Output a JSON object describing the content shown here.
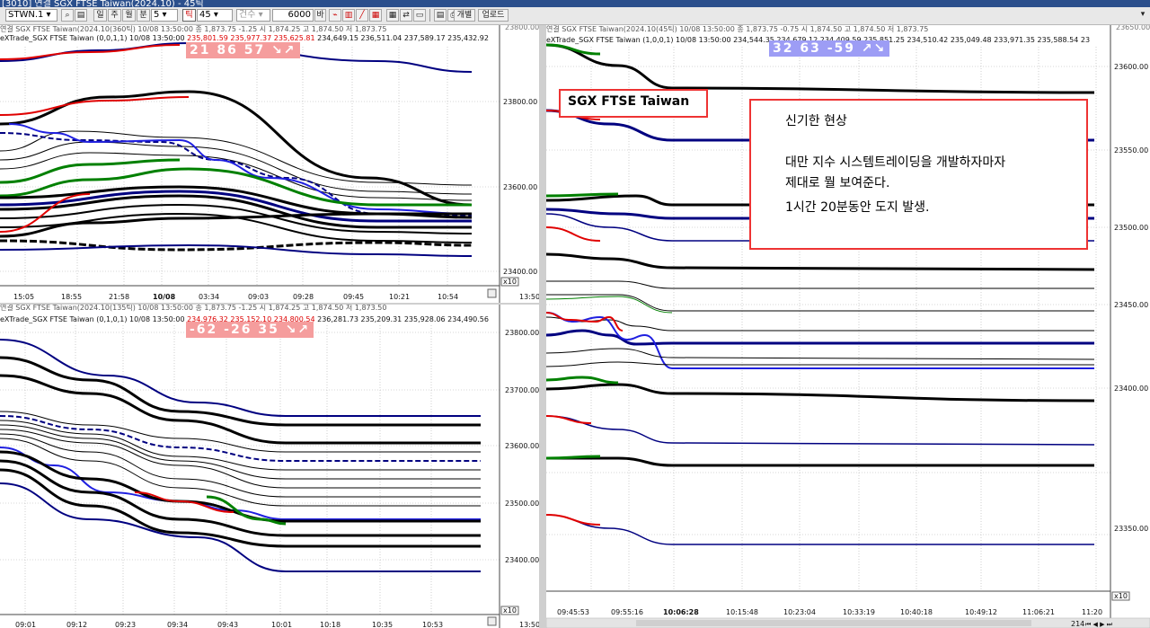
{
  "titlebar": {
    "text": "[3010] 연결 SGX FTSE Taiwan(2024.10) - 45틱"
  },
  "toolbar": {
    "symbol": "STWN.1",
    "period_buttons": [
      "일",
      "주",
      "월",
      "분"
    ],
    "minute_value": "5",
    "tick_label": "틱",
    "tick_value": "45",
    "count_placeholder": "건수",
    "count_value": "6000",
    "count_unit": "바",
    "mode_label": "개별",
    "update_label": "업로드"
  },
  "colors": {
    "up": "#e00000",
    "down": "#000080",
    "green": "#008000",
    "black": "#000000",
    "blue": "#1f1fe0",
    "frame": "#e33333"
  },
  "panels": [
    {
      "id": "top-left",
      "header_prev": "연결 SGX FTSE Taiwan(2024.10(360틱) 10/08 13:50:00  종 1,873.75 -1.25  시 1,874.25 고 1,874.50 저 1,873.75",
      "header_prefix": "eXTrade_SGX FTSE Taiwan  (0,0,1,1) 10/08 13:50:00 ",
      "header_red": "235,801.59 235,977.37 235,625.81",
      "header_rest": " 234,649.15 236,511.04 237,589.17 235,432.92",
      "badge": "21  86  57 ↘↗",
      "yaxis": [
        "23800.00",
        "23600.00",
        "23400.00"
      ],
      "xaxis": [
        "15:05",
        "18:55",
        "21:58",
        "10/08",
        "03:34",
        "09:03",
        "09:28",
        "09:45",
        "10:21",
        "10:54"
      ],
      "xaxis_bold": "10/08",
      "scale": "x10",
      "corner_time": "13:50",
      "top_label": "23800.00"
    },
    {
      "id": "bottom-left",
      "header_prev": "연결 SGX FTSE Taiwan(2024.10(135틱) 10/08 13:50:00  종 1,873.75 -1.25  시 1,874.25 고 1,874.50 저 1,873.50",
      "header_prefix": "eXTrade_SGX FTSE Taiwan  (0,1,0,1) 10/08 13:50:00 ",
      "header_red": "234,976.32 235,152.10 234,800.54",
      "header_rest": " 236,281.73 235,209.31 235,928.06 234,490.56",
      "badge": "-62  -26  35 ↘↗",
      "yaxis": [
        "23800.00",
        "23700.00",
        "23600.00",
        "23500.00",
        "23400.00"
      ],
      "xaxis": [
        "09:01",
        "09:12",
        "09:23",
        "09:34",
        "09:43",
        "10:01",
        "10:18",
        "10:35",
        "10:53"
      ],
      "scale": "x10",
      "corner_time": "13:50"
    },
    {
      "id": "right",
      "header_prev": "연결 SGX FTSE Taiwan(2024.10(45틱) 10/08 13:50:00  종 1,873.75 -0.75  시 1,874.50 고 1,874.50 저 1,873.75",
      "header_prefix": "eXTrade_SGX FTSE Taiwan  (1,0,0,1) 10/08 13:50:00 ",
      "header_red": "",
      "header_rest": "234,544.35 234,679.12 234,409.59 235,851.25 234,510.42 235,049.48 233,971.35 235,588.54 23",
      "badge": "32  63  -59 ↗↘",
      "yaxis": [
        "23600.00",
        "23550.00",
        "23500.00",
        "23450.00",
        "23400.00",
        "23350.00"
      ],
      "xaxis": [
        "09:45:53",
        "09:55:16",
        "10:06:28",
        "10:15:48",
        "10:23:04",
        "10:33:19",
        "10:40:18",
        "10:49:12",
        "11:06:21",
        "11:20"
      ],
      "xaxis_bold": "10:06:28",
      "scale": "x10",
      "scroll_value": "214",
      "top_label": "23650.00"
    }
  ],
  "labels": {
    "box_title": "SGX FTSE Taiwan"
  },
  "annotation": {
    "title": "신기한 현상",
    "line1": "대만 지수 시스템트레이딩을 개발하자마자",
    "line2": "제대로 뭘 보여준다.",
    "line3": "1시간 20분동안 도지 발생."
  }
}
